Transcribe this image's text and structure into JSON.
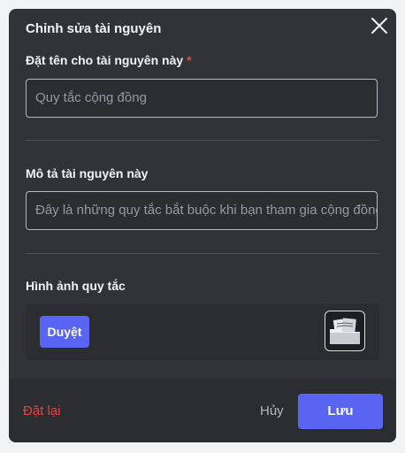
{
  "dialog": {
    "title": "Chỉnh sửa tài nguyên",
    "close_icon": "close-icon"
  },
  "name_field": {
    "label": "Đặt tên cho tài nguyên này",
    "required_mark": "*",
    "placeholder": "Quy tắc cộng đồng"
  },
  "description_field": {
    "label": "Mô tả tài nguyên này",
    "placeholder": "Đây là những quy tắc bắt buộc khi bạn tham gia cộng đồng"
  },
  "image_field": {
    "label": "Hình ảnh quy tắc",
    "browse_label": "Duyệt",
    "thumbnail_icon": "folder-documents-icon"
  },
  "footer": {
    "reset_label": "Đặt lại",
    "cancel_label": "Hủy",
    "save_label": "Lưu"
  },
  "colors": {
    "accent": "#5865f2",
    "danger": "#f23f43",
    "background": "#313338"
  }
}
